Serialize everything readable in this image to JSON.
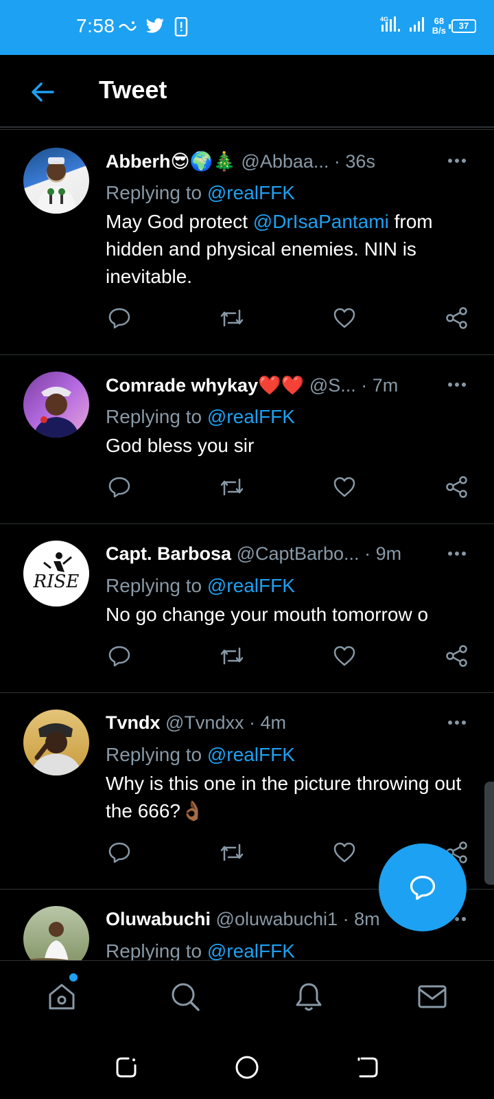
{
  "status_bar": {
    "time": "7:58",
    "net_speed_value": "68",
    "net_speed_unit": "B/s",
    "battery": "37",
    "network_type": "4G"
  },
  "header": {
    "title": "Tweet"
  },
  "tweets": [
    {
      "name": "Abberh😎🌍🎄",
      "handle": "@Abbaa...",
      "time": "· 36s",
      "replying_prefix": "Replying to ",
      "replying_to": "@realFFK",
      "body_pre": "May God protect ",
      "body_mention": "@DrIsaPantami",
      "body_post": " from hidden and physical enemies. NIN is inevitable."
    },
    {
      "name": "Comrade whykay❤️❤️",
      "handle": "@S...",
      "time": "· 7m",
      "replying_prefix": "Replying to ",
      "replying_to": "@realFFK",
      "body": "God bless you sir"
    },
    {
      "name": "Capt. Barbosa",
      "handle": "@CaptBarbo...",
      "time": "· 9m",
      "replying_prefix": "Replying to ",
      "replying_to": "@realFFK",
      "body": "No go change your mouth tomorrow o",
      "avatar_text": "RISE"
    },
    {
      "name": "Tvndx",
      "handle": "@Tvndxx",
      "time": "· 4m",
      "replying_prefix": "Replying to ",
      "replying_to": "@realFFK",
      "body": "Why is this one in the picture throwing out the 666?👌🏾"
    },
    {
      "name": "Oluwabuchi",
      "handle": "@oluwabuchi1",
      "time": "· 8m",
      "replying_prefix": "Replying to ",
      "replying_to": "@realFFK"
    }
  ],
  "icons": {
    "back": "arrow-left-icon",
    "reply": "comment-icon",
    "retweet": "retweet-icon",
    "like": "heart-icon",
    "share": "share-icon",
    "compose": "compose-reply-icon",
    "home": "home-icon",
    "search": "search-icon",
    "notifications": "bell-icon",
    "messages": "mail-icon"
  },
  "colors": {
    "accent": "#1DA1F2",
    "background": "#000000",
    "secondary_text": "#8899a6",
    "divider": "#2f3336"
  }
}
